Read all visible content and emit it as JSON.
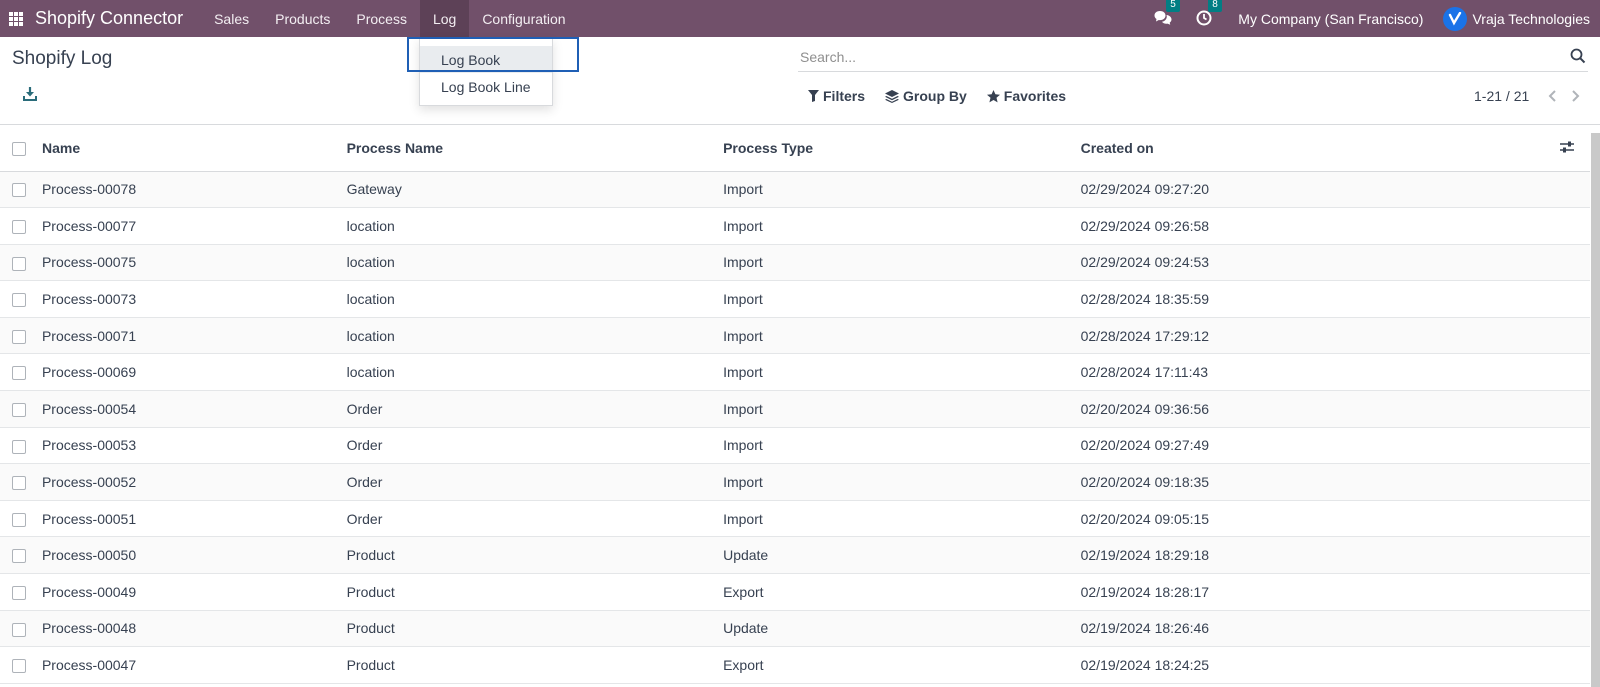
{
  "navbar": {
    "app_title": "Shopify Connector",
    "menu": [
      "Sales",
      "Products",
      "Process",
      "Log",
      "Configuration"
    ],
    "active_menu": "Log",
    "messages_count": "5",
    "activities_count": "8",
    "company": "My Company (San Francisco)",
    "user": "Vraja Technologies",
    "bg_color": "#71506a"
  },
  "dropdown": {
    "items": [
      "Log Book",
      "Log Book Line"
    ]
  },
  "control_panel": {
    "title": "Shopify Log",
    "search_placeholder": "Search...",
    "filters_label": "Filters",
    "group_by_label": "Group By",
    "favorites_label": "Favorites",
    "pager": "1-21 / 21"
  },
  "table": {
    "columns": [
      "Name",
      "Process Name",
      "Process Type",
      "Created on"
    ],
    "rows": [
      [
        "Process-00078",
        "Gateway",
        "Import",
        "02/29/2024 09:27:20"
      ],
      [
        "Process-00077",
        "location",
        "Import",
        "02/29/2024 09:26:58"
      ],
      [
        "Process-00075",
        "location",
        "Import",
        "02/29/2024 09:24:53"
      ],
      [
        "Process-00073",
        "location",
        "Import",
        "02/28/2024 18:35:59"
      ],
      [
        "Process-00071",
        "location",
        "Import",
        "02/28/2024 17:29:12"
      ],
      [
        "Process-00069",
        "location",
        "Import",
        "02/28/2024 17:11:43"
      ],
      [
        "Process-00054",
        "Order",
        "Import",
        "02/20/2024 09:36:56"
      ],
      [
        "Process-00053",
        "Order",
        "Import",
        "02/20/2024 09:27:49"
      ],
      [
        "Process-00052",
        "Order",
        "Import",
        "02/20/2024 09:18:35"
      ],
      [
        "Process-00051",
        "Order",
        "Import",
        "02/20/2024 09:05:15"
      ],
      [
        "Process-00050",
        "Product",
        "Update",
        "02/19/2024 18:29:18"
      ],
      [
        "Process-00049",
        "Product",
        "Export",
        "02/19/2024 18:28:17"
      ],
      [
        "Process-00048",
        "Product",
        "Update",
        "02/19/2024 18:26:46"
      ],
      [
        "Process-00047",
        "Product",
        "Export",
        "02/19/2024 18:24:25"
      ]
    ]
  }
}
